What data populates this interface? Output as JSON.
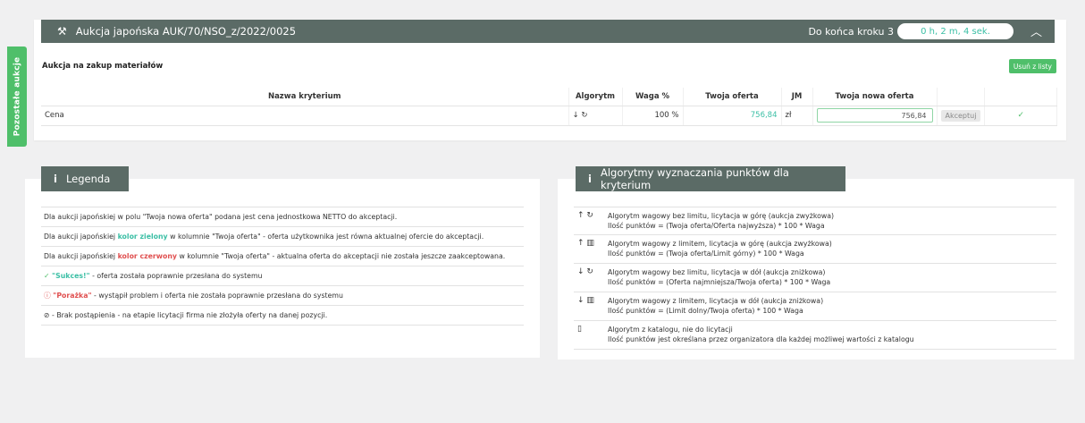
{
  "side_tab": {
    "label": "Pozostałe aukcje"
  },
  "auction": {
    "title": "Aukcja japońska AUK/70/NSO_z/2022/0025",
    "countdown_label": "Do końca kroku 3",
    "countdown_value": "0 h, 2 m, 4 sek.",
    "subtitle": "Aukcja na zakup materiałów",
    "remove_button": "Usuń z listy",
    "table": {
      "headers": [
        "Nazwa kryterium",
        "Algorytm",
        "Waga %",
        "Twoja oferta",
        "JM",
        "Twoja nowa oferta"
      ],
      "row": {
        "name": "Cena",
        "algorithm_icon": "↓ ↻",
        "weight": "100 %",
        "offer": "756,84",
        "unit": "zł",
        "new_offer": "756,84",
        "accept": "Akceptuj"
      }
    }
  },
  "legend": {
    "title": "Legenda",
    "rows": [
      {
        "pre": "Dla aukcji japońskiej w polu \"Twoja nowa oferta\" podana jest cena jednostkowa NETTO do akceptacji.",
        "hl": "",
        "post": ""
      },
      {
        "pre": "Dla aukcji japońskiej ",
        "hl": "kolor zielony",
        "post": " w kolumnie \"Twoja oferta\" - oferta użytkownika jest równa aktualnej ofercie do akceptacji."
      },
      {
        "pre": "Dla aukcji japońskiej ",
        "hl": "kolor czerwony",
        "post": " w kolumnie \"Twoja oferta\" - aktualna oferta do akceptacji nie została jeszcze zaakceptowana."
      }
    ],
    "success_label": "\"Sukces!\"",
    "success_text": " - oferta została poprawnie przesłana do systemu",
    "failure_label": "\"Porażka\"",
    "failure_text": " - wystąpił problem i oferta nie została poprawnie przesłana do systemu",
    "no_bid_text": " - Brak postąpienia - na etapie licytacji firma nie złożyła oferty na danej pozycji."
  },
  "algorithms": {
    "title": "Algorytmy wyznaczania punktów dla kryterium",
    "items": [
      {
        "icon": "↑ ↻",
        "line1": "Algorytm wagowy bez limitu, licytacja w górę (aukcja zwyżkowa)",
        "line2": "Ilość punktów = (Twoja oferta/Oferta najwyższa) * 100 * Waga"
      },
      {
        "icon": "↑ ▥",
        "line1": "Algorytm wagowy z limitem, licytacja w górę (aukcja zwyżkowa)",
        "line2": "Ilość punktów = (Twoja oferta/Limit górny) * 100 * Waga"
      },
      {
        "icon": "↓ ↻",
        "line1": "Algorytm wagowy bez limitu, licytacja w dół (aukcja zniżkowa)",
        "line2": "Ilość punktów = (Oferta najmniejsza/Twoja oferta) * 100 * Waga"
      },
      {
        "icon": "↓ ▥",
        "line1": "Algorytm wagowy z limitem, licytacja w dół (aukcja zniżkowa)",
        "line2": "Ilość punktów = (Limit dolny/Twoja oferta) * 100 * Waga"
      },
      {
        "icon": "▯",
        "line1": "Algorytm z katalogu, nie do licytacji",
        "line2": "Ilość punktów jest określana przez organizatora dla każdej możliwej wartości z katalogu"
      }
    ]
  }
}
